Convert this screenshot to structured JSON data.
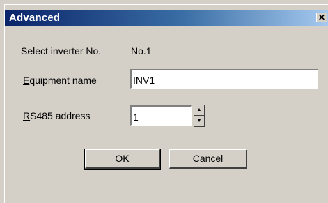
{
  "window": {
    "title": "Advanced",
    "close_glyph": "✕"
  },
  "form": {
    "inverter_label": "Select inverter No.",
    "inverter_value": "No.1",
    "equipment_label_accel": "E",
    "equipment_label_rest": "quipment name",
    "equipment_value": "INV1",
    "rs485_label_accel": "R",
    "rs485_label_rest": "S485 address",
    "rs485_value": "1",
    "spin_up_icon": "triangle-up",
    "spin_down_icon": "triangle-down"
  },
  "buttons": {
    "ok": "OK",
    "cancel": "Cancel"
  }
}
